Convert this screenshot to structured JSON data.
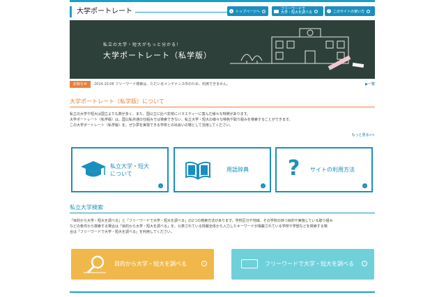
{
  "header": {
    "title": "大学ポートレート",
    "nav": [
      {
        "label": "トップページへ",
        "icon": "home-icon"
      },
      {
        "label": "フリーワードで\n大学・短大を調べる",
        "icon": "search-box-icon"
      },
      {
        "label": "このサイトの使い方",
        "icon": "question-icon"
      }
    ]
  },
  "hero": {
    "subtitle": "私立の大学・短大がもっと分かる！",
    "title": "大学ポートレート（私学版）"
  },
  "news": {
    "badge": "お知らせ",
    "text": "2014.10.06 フリーワード検索は、ただいまメンテナンス中のため、利用できません。",
    "list_link": "▶一覧"
  },
  "about": {
    "title": "大学ポートレート（私学版）について",
    "lines": [
      "私立の大学や短大は国立よりも数が多く、また、国公立に比べ非常にバラエティーに富んだ様々な特徴があります。",
      "大学ポートレート（私学版）は、国公私共通の仕組みでは検索できない、私立大学・短大の様々な特色や取り組みを検索することができます。",
      "この大学ポートレート（私学版）を、ぜひ夢を実現できる学校との出会いの場として活用してください。"
    ],
    "more": "もっと見る>>"
  },
  "cards": [
    {
      "label": "私立大学・短大\nについて",
      "icon": "graduation-cap-icon"
    },
    {
      "label": "用語辞典",
      "icon": "book-icon"
    },
    {
      "label": "サイトの利用方法",
      "icon": "question-mark-icon"
    }
  ],
  "search": {
    "title": "私立大学検索",
    "lines": [
      "「目的から大学・短大を調べる」と「フリーワードで大学・短大を調べる」の2つの検索方法があります。学校区分や地域、その学校の持つ目的や実施している取り組み",
      "などの条件から検索する場合は「目的から大学・短大を調べる」を、公表されている情報全体から入力したキーワードが掲載されている学校や学部などを検索する場",
      "合は「フリーワードで大学・短大を調べる」を利用してください。"
    ],
    "btn_purpose": "目的から大学・短大を調べる",
    "btn_free": "フリーワードで大学・短大を調べる"
  },
  "colors": {
    "accent": "#1a8fbf",
    "orange": "#e7813a",
    "yellow": "#f0b84a",
    "cyan": "#6fd0da",
    "chalkboard": "#2e403a"
  }
}
